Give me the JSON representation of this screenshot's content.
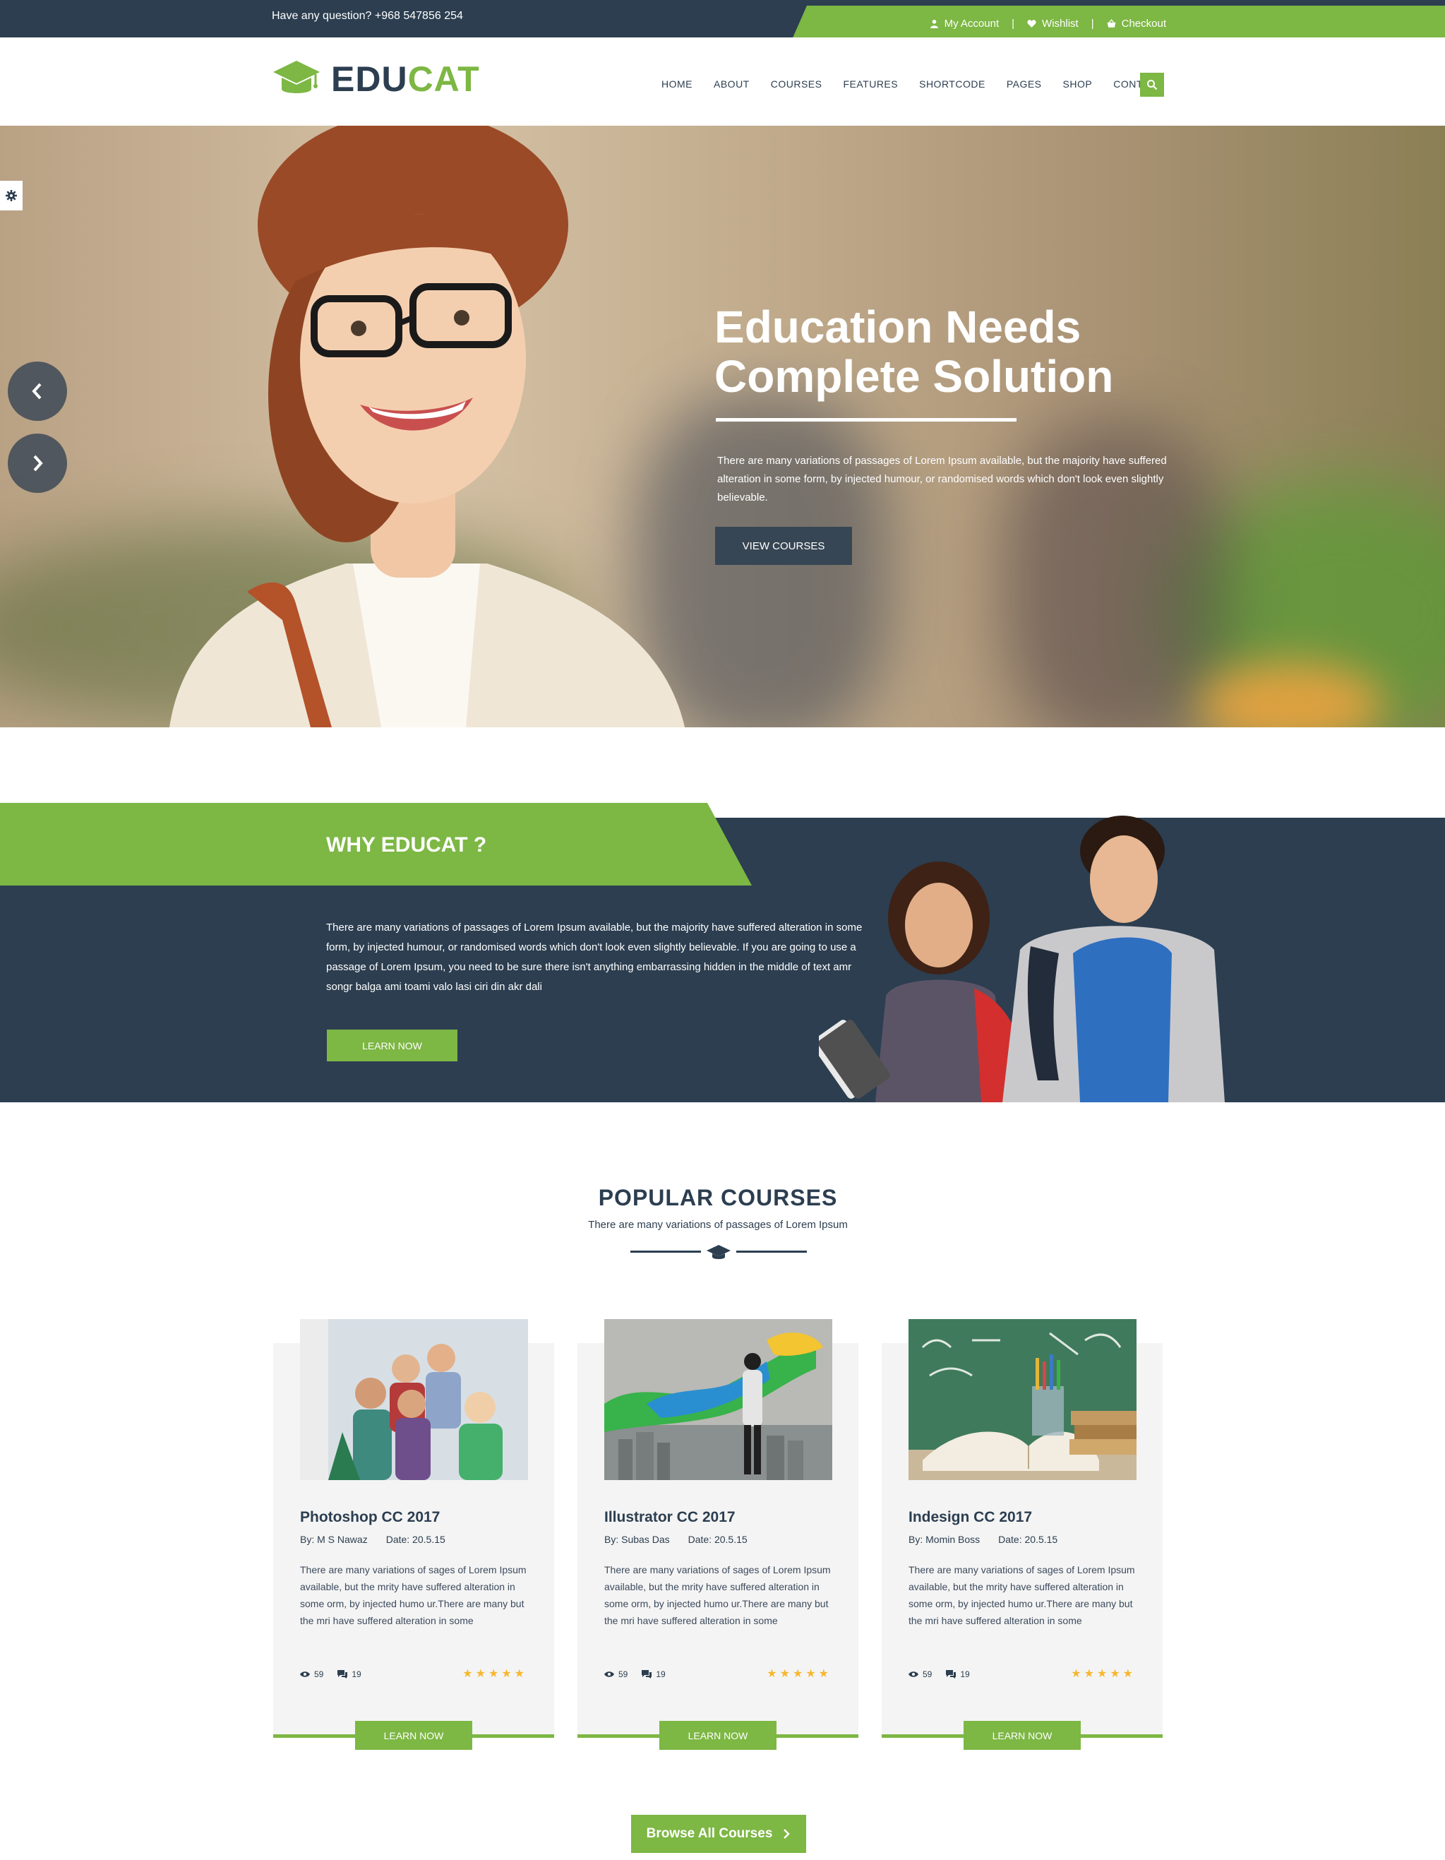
{
  "topbar": {
    "question": "Have any question? +968 547856 254",
    "links": {
      "account": "My Account",
      "wishlist": "Wishlist",
      "checkout": "Checkout"
    },
    "separator": "|"
  },
  "header": {
    "logo_part1": "EDU",
    "logo_part2": "CAT",
    "nav": [
      "HOME",
      "ABOUT",
      "COURSES",
      "FEATURES",
      "SHORTCODE",
      "PAGES",
      "SHOP",
      "CONTACT"
    ]
  },
  "hero": {
    "title_line1": "Education Needs",
    "title_line2": "Complete Solution",
    "text": "There are many variations of passages of Lorem Ipsum available, but the majority have suffered alteration in some form, by injected humour, or randomised words which don't look even slightly believable.",
    "button": "VIEW COURSES"
  },
  "why": {
    "title": "WHY EDUCAT ?",
    "text": "There are many variations of passages of Lorem Ipsum available, but the majority have suffered alteration in some form, by injected humour, or randomised words which don't look even slightly believable. If you are going to use a passage of Lorem Ipsum, you need to be sure there isn't anything embarrassing hidden in the middle of text amr songr balga ami toami valo lasi ciri din akr dali",
    "button": "LEARN NOW"
  },
  "popular": {
    "title": "POPULAR COURSES",
    "subtitle": "There are many variations of passages of Lorem Ipsum",
    "courses": [
      {
        "title": "Photoshop CC 2017",
        "author": "By: M S Nawaz",
        "date": "Date: 20.5.15",
        "text": "There are many variations of sages of Lorem Ipsum available, but the mrity have suffered alteration in some orm, by injected humo ur.There are many but the mri have suffered alteration in some",
        "views": "59",
        "comments": "19",
        "rating": "★★★★★",
        "button": "LEARN NOW"
      },
      {
        "title": "Illustrator CC 2017",
        "author": "By: Subas Das",
        "date": "Date: 20.5.15",
        "text": "There are many variations of sages of Lorem Ipsum available, but the mrity have suffered alteration in some orm, by injected humo ur.There are many but the mri have suffered alteration in some",
        "views": "59",
        "comments": "19",
        "rating": "★★★★★",
        "button": "LEARN NOW"
      },
      {
        "title": "Indesign CC 2017",
        "author": "By: Momin Boss",
        "date": "Date: 20.5.15",
        "text": "There are many variations of sages of Lorem Ipsum available, but the mrity have suffered alteration in some orm, by injected humo ur.There are many but the mri have suffered alteration in some",
        "views": "59",
        "comments": "19",
        "rating": "★★★★★",
        "button": "LEARN NOW"
      }
    ],
    "browse_button": "Browse All Courses"
  },
  "colors": {
    "brand_green": "#7db744",
    "navy": "#2c3e50",
    "star": "#f5b82e"
  },
  "icons": [
    "user-icon",
    "heart-icon",
    "basket-icon",
    "graduation-cap-icon",
    "search-icon",
    "gear-icon",
    "chevron-left-icon",
    "chevron-right-icon",
    "eye-icon",
    "comment-icon",
    "star-icon"
  ]
}
